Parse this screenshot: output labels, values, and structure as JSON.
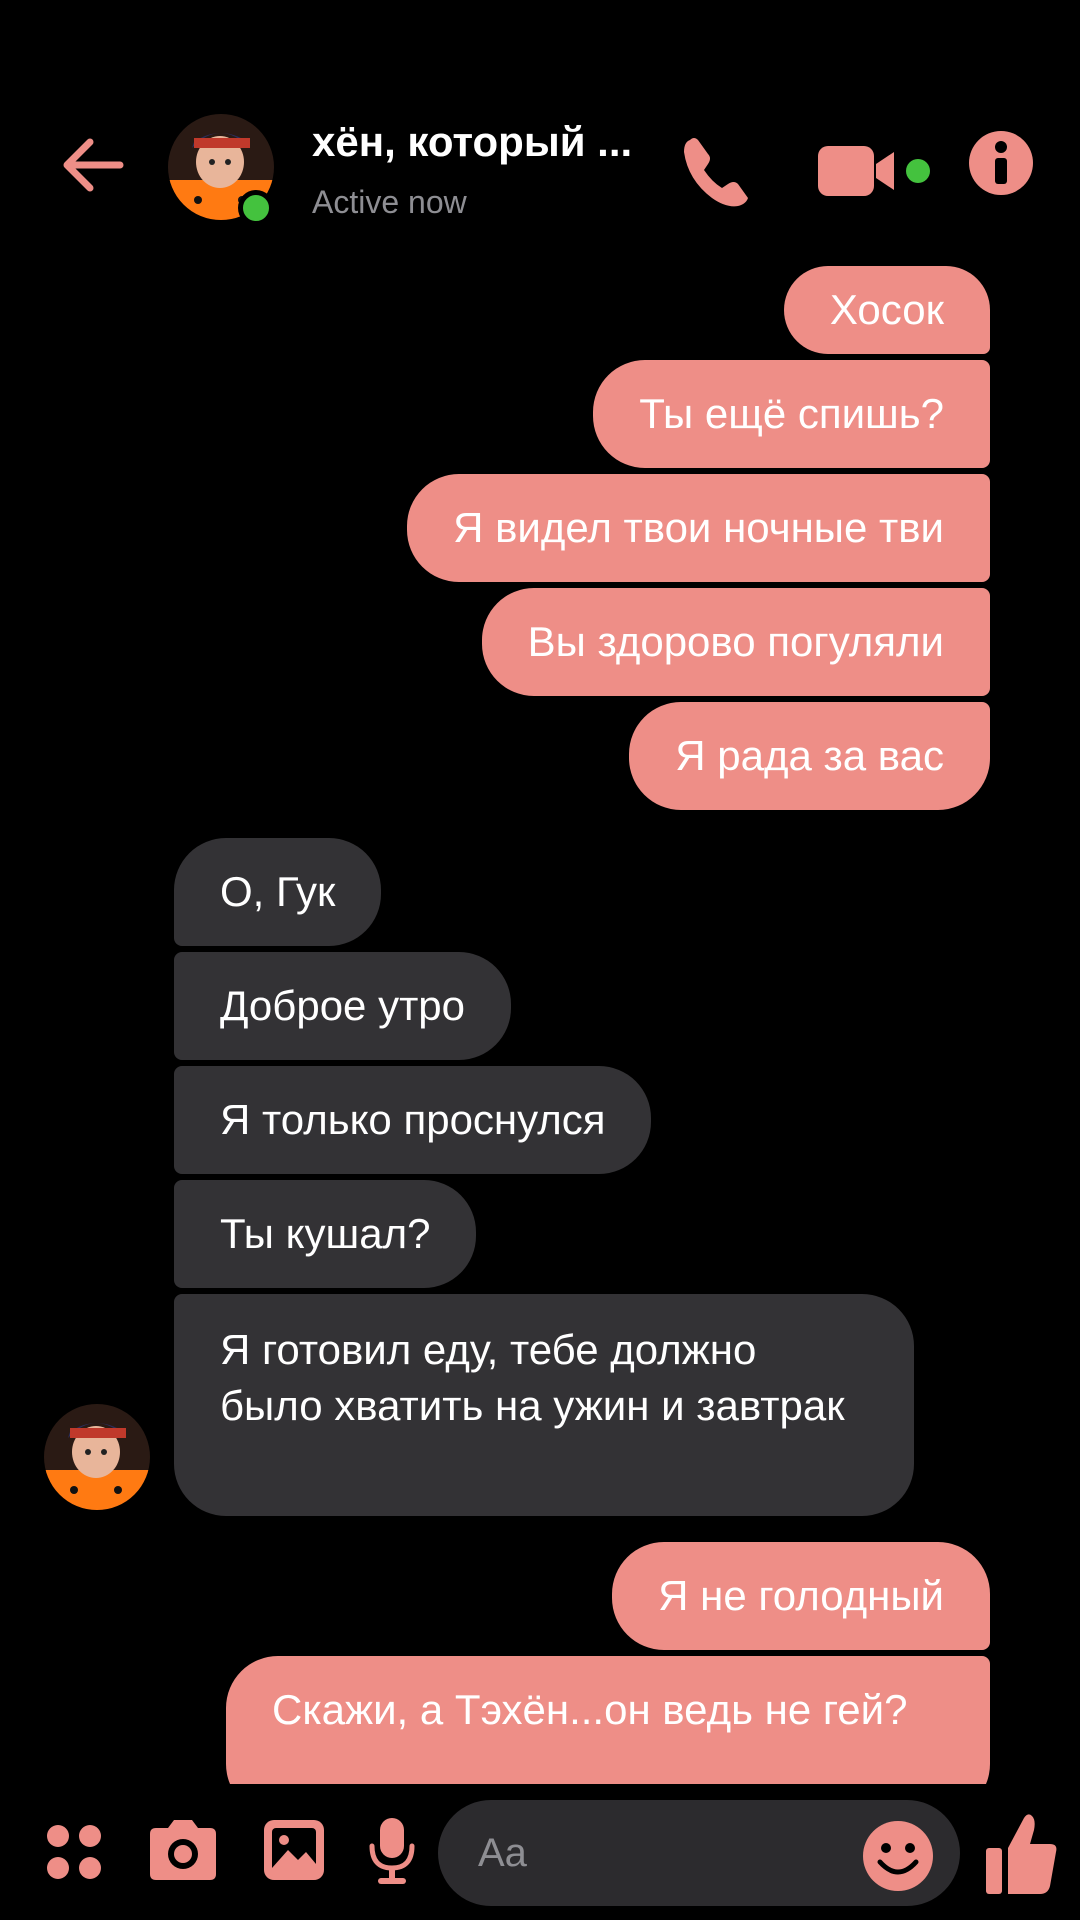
{
  "header": {
    "title": "хён, который ...",
    "status": "Active now"
  },
  "messages": [
    {
      "side": "out",
      "text": "Хосок"
    },
    {
      "side": "out",
      "text": "Ты ещё спишь?"
    },
    {
      "side": "out",
      "text": "Я видел твои ночные тви"
    },
    {
      "side": "out",
      "text": "Вы здорово погуляли"
    },
    {
      "side": "out",
      "text": "Я рада за вас"
    },
    {
      "side": "in",
      "text": "О, Гук"
    },
    {
      "side": "in",
      "text": "Доброе утро"
    },
    {
      "side": "in",
      "text": "Я только проснулся"
    },
    {
      "side": "in",
      "text": "Ты кушал?"
    },
    {
      "side": "in",
      "text": "Я готовил еду, тебе должно было хватить на ужин и завтрак"
    },
    {
      "side": "out",
      "text": "Я не голодный"
    },
    {
      "side": "out",
      "text": "Скажи, а Тэхён...он ведь не гей?"
    }
  ],
  "composer": {
    "placeholder": "Aa"
  },
  "colors": {
    "accent": "#ee8e87",
    "incoming_bubble": "#333235",
    "online": "#44c23e",
    "background": "#000000"
  },
  "icons": [
    "back-arrow-icon",
    "phone-icon",
    "video-camera-icon",
    "info-icon",
    "apps-icon",
    "camera-icon",
    "gallery-icon",
    "microphone-icon",
    "emoji-icon",
    "thumbs-up-icon"
  ]
}
